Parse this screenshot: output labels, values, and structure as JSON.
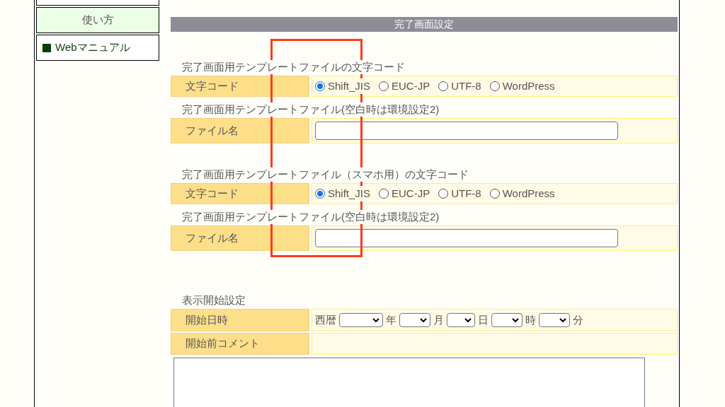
{
  "sidebar": {
    "items": [
      {
        "label": "使い方",
        "kind": "heading"
      },
      {
        "label": "Webマニュアル",
        "kind": "link"
      }
    ]
  },
  "panel": {
    "title": "完了画面設定",
    "sections": [
      {
        "rows": [
          {
            "kind": "caption",
            "text": "完了画面用テンプレートファイルの文字コード"
          },
          {
            "kind": "radio",
            "label": "文字コード",
            "options": [
              {
                "label": "Shift_JIS",
                "selected": true
              },
              {
                "label": "EUC-JP",
                "selected": false
              },
              {
                "label": "UTF-8",
                "selected": false
              },
              {
                "label": "WordPress",
                "selected": false
              }
            ]
          },
          {
            "kind": "caption",
            "text": "完了画面用テンプレートファイル(空白時は環境設定2)"
          },
          {
            "kind": "text",
            "label": "ファイル名"
          }
        ]
      },
      {
        "rows": [
          {
            "kind": "caption",
            "text": "完了画面用テンプレートファイル（スマホ用）の文字コード"
          },
          {
            "kind": "radio",
            "label": "文字コード",
            "options": [
              {
                "label": "Shift_JIS",
                "selected": true
              },
              {
                "label": "EUC-JP",
                "selected": false
              },
              {
                "label": "UTF-8",
                "selected": false
              },
              {
                "label": "WordPress",
                "selected": false
              }
            ]
          },
          {
            "kind": "caption",
            "text": "完了画面用テンプレートファイル(空白時は環境設定2)"
          },
          {
            "kind": "text",
            "label": "ファイル名"
          }
        ]
      },
      {
        "rows": [
          {
            "kind": "caption",
            "text": "表示開始設定"
          },
          {
            "kind": "datetime",
            "label": "開始日時",
            "prefix": "西暦",
            "selects": [
              {
                "unit": "年"
              },
              {
                "unit": "月"
              },
              {
                "unit": "日"
              },
              {
                "unit": "時"
              },
              {
                "unit": "分"
              }
            ]
          },
          {
            "kind": "empty",
            "label": "開始前コメント"
          },
          {
            "kind": "textarea"
          }
        ]
      }
    ]
  },
  "annotation": {
    "kind": "rectangle"
  }
}
